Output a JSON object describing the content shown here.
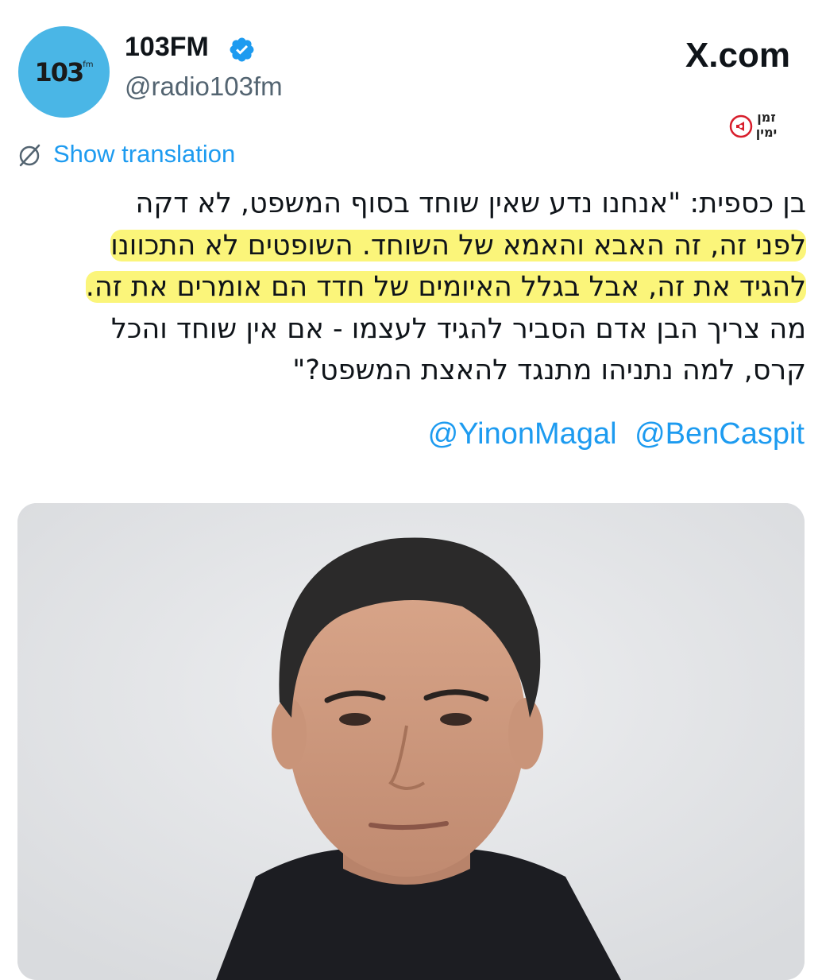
{
  "account": {
    "avatar_logo": "103",
    "avatar_logo_sup": "fm",
    "display_name": "103FM",
    "handle": "@radio103fm",
    "verified": true
  },
  "source": {
    "site": "X.com"
  },
  "channel_badge": {
    "line1": "זמן",
    "line2": "ימין"
  },
  "tweet": {
    "translate_label": "Show translation",
    "lines": [
      "בן כספית: \"אנחנו נדע שאין שוחד בסוף המשפט, לא דקה",
      "לפני זה, זה האבא והאמא של השוחד. השופטים לא התכוונו",
      "להגיד את זה, אבל בגלל האיומים של חדד הם אומרים את זה.",
      "מה צריך הבן אדם הסביר להגיד לעצמו - אם אין שוחד והכל",
      "קרס, למה נתניהו מתנגד להאצת המשפט?\""
    ],
    "mentions": [
      "@YinonMagal",
      "@BenCaspit"
    ]
  },
  "media": {
    "kind": "portrait-photo",
    "background": "#e6e7e9"
  },
  "colors": {
    "link": "#1d9bf0",
    "avatar_bg": "#4ab6e6",
    "highlight": "#fbf57a",
    "secondary_text": "#536471"
  },
  "icons": [
    "verified-badge-icon",
    "translate-icon",
    "megaphone-icon"
  ]
}
